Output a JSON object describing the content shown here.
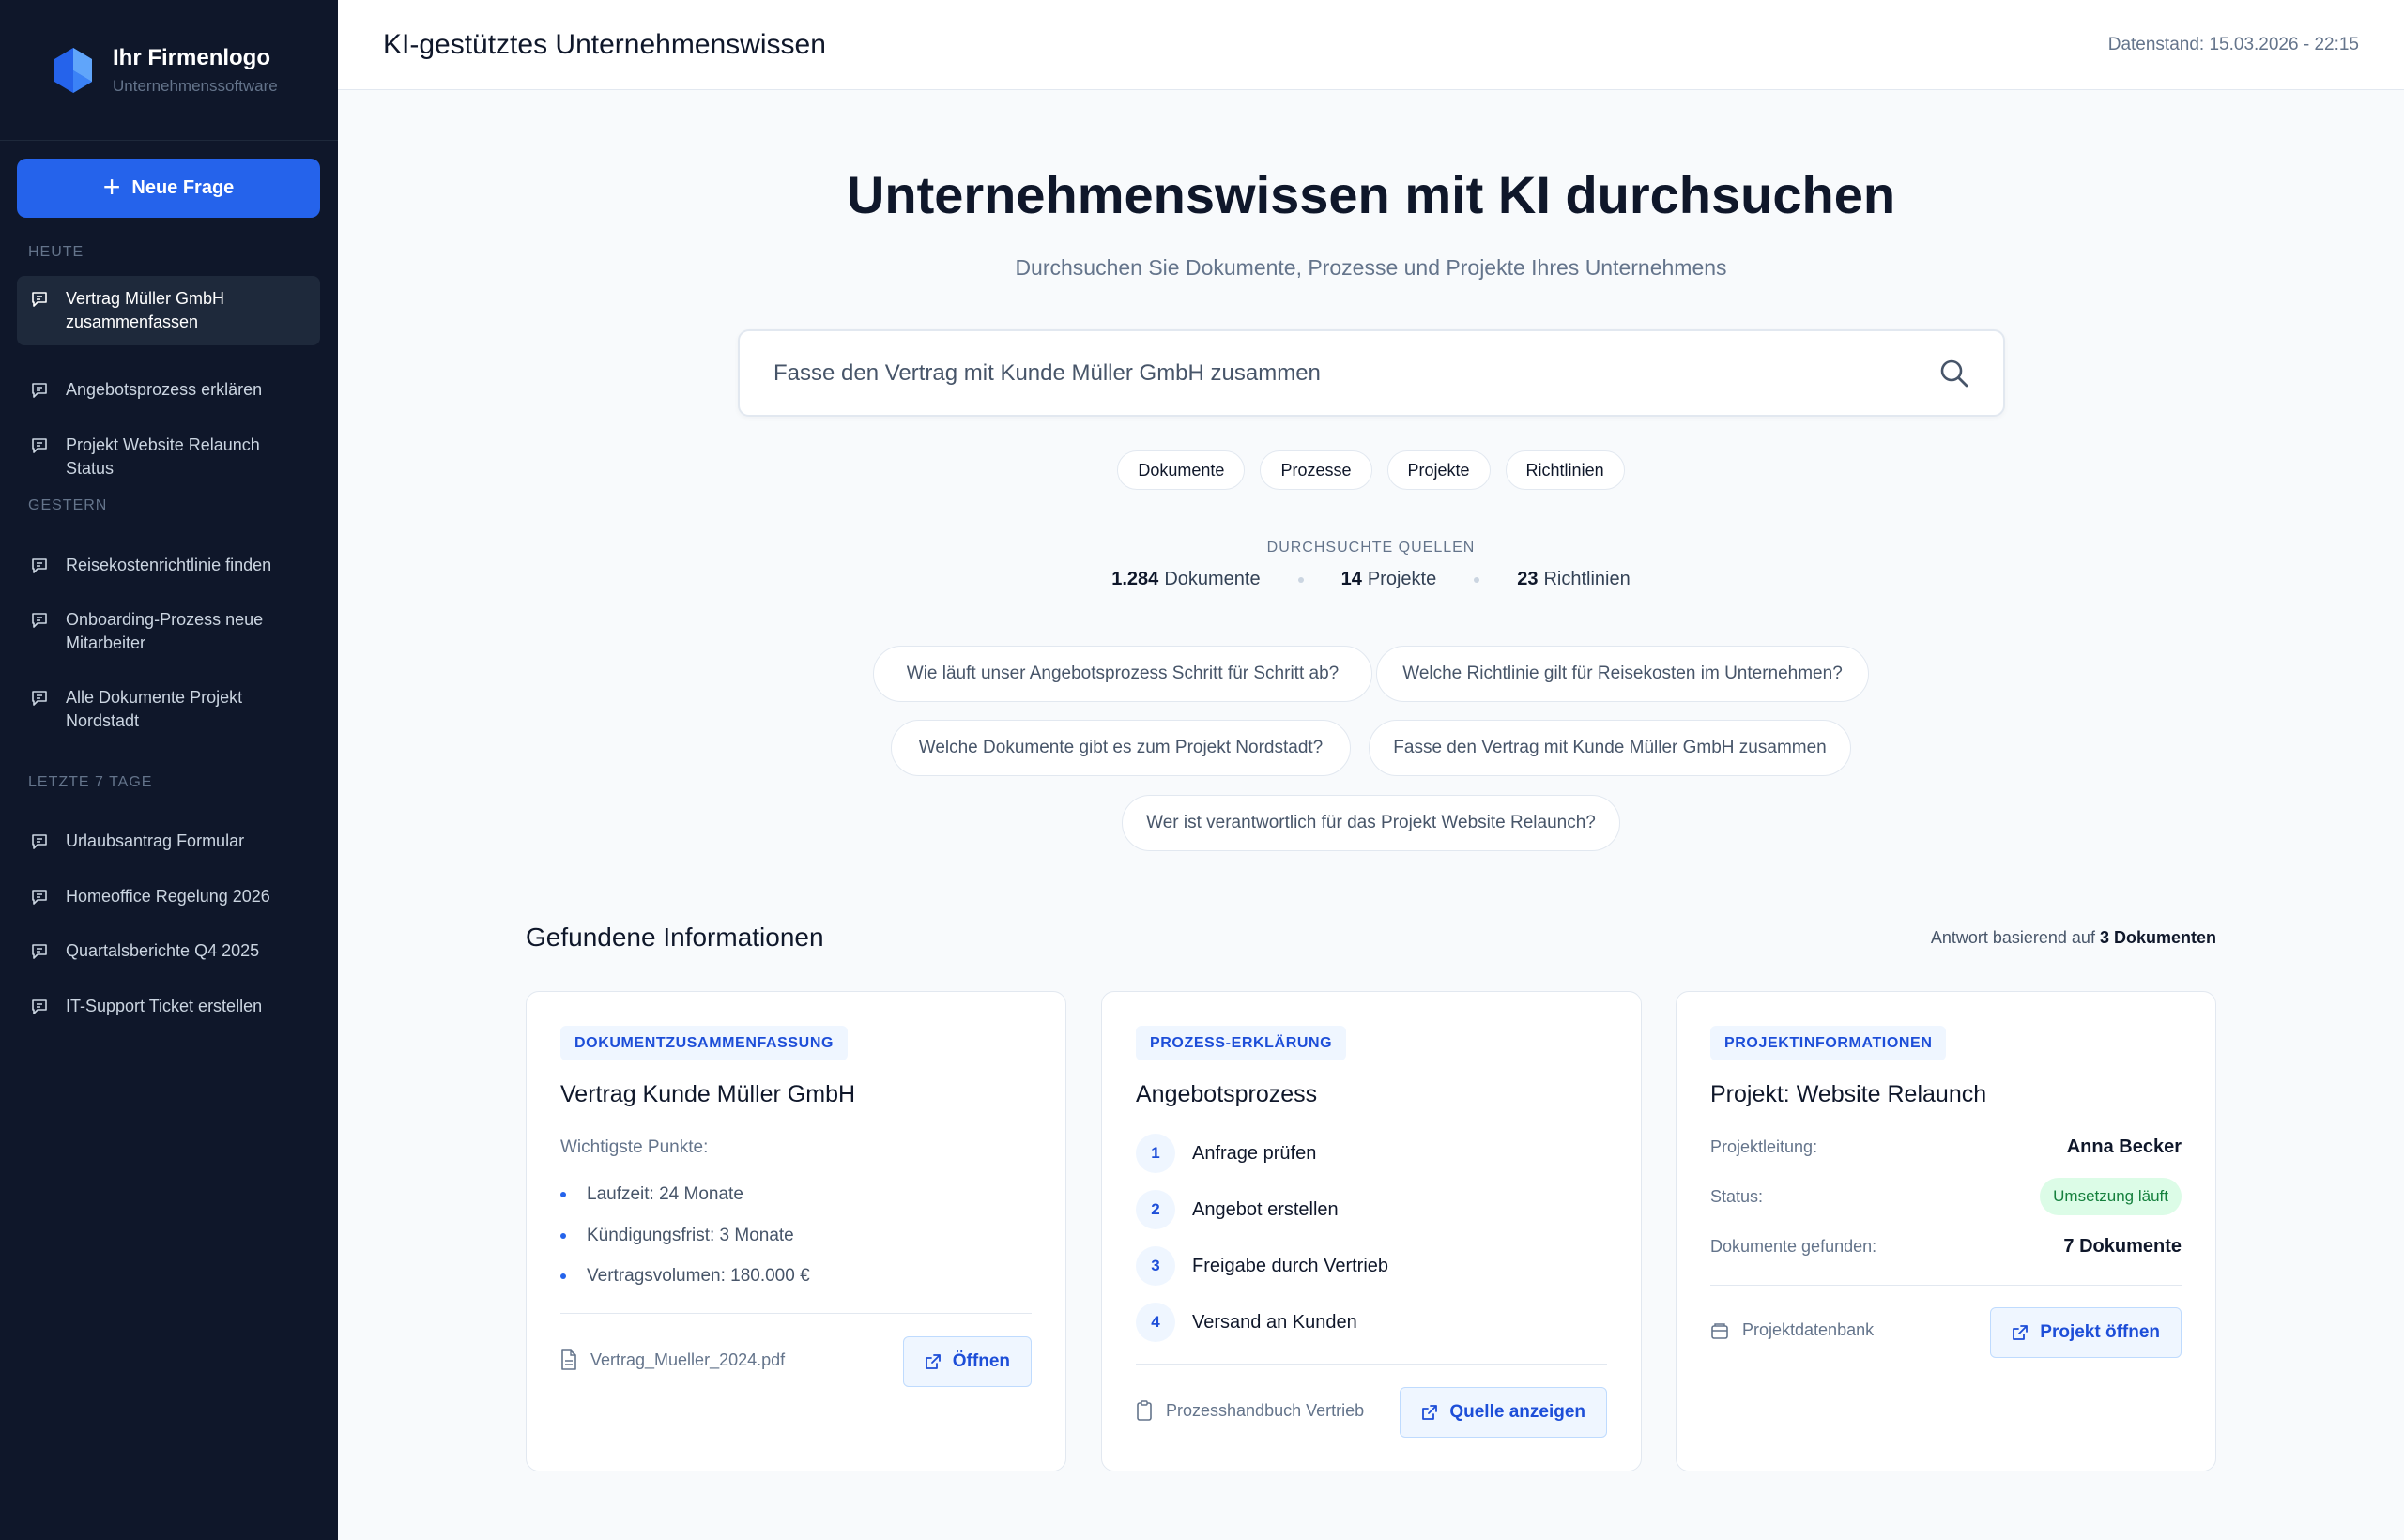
{
  "colors": {
    "accent": "#2563eb",
    "sidebar": "#0f172a",
    "status_green": "#15803d"
  },
  "brand": {
    "title": "Ihr Firmenlogo",
    "subtitle": "Unternehmenssoftware"
  },
  "sidebar": {
    "new_button": "Neue Frage",
    "sections": [
      {
        "label": "HEUTE",
        "items": [
          "Vertrag Müller GmbH zusammenfassen",
          "Angebotsprozess erklären",
          "Projekt Website Relaunch Status"
        ]
      },
      {
        "label": "GESTERN",
        "items": [
          "Reisekostenrichtlinie finden",
          "Onboarding-Prozess neue Mitarbeiter",
          "Alle Dokumente Projekt Nordstadt"
        ]
      },
      {
        "label": "LETZTE 7 TAGE",
        "items": [
          "Urlaubsantrag Formular",
          "Homeoffice Regelung 2026",
          "Quartalsberichte Q4 2025",
          "IT-Support Ticket erstellen"
        ]
      }
    ]
  },
  "header": {
    "title": "KI-gestütztes Unternehmenswissen",
    "data_status": "Datenstand: 15.03.2026 - 22:15"
  },
  "hero": {
    "title": "Unternehmenswissen mit KI durchsuchen",
    "subtitle": "Durchsuchen Sie Dokumente, Prozesse und Projekte Ihres Unternehmens"
  },
  "search": {
    "placeholder": "Fasse den Vertrag mit Kunde Müller GmbH zusammen"
  },
  "filters": [
    "Dokumente",
    "Prozesse",
    "Projekte",
    "Richtlinien"
  ],
  "sources": {
    "label": "DURCHSUCHTE QUELLEN",
    "items": [
      {
        "count": "1.284",
        "label": "Dokumente"
      },
      {
        "count": "14",
        "label": "Projekte"
      },
      {
        "count": "23",
        "label": "Richtlinien"
      }
    ]
  },
  "suggestions": [
    "Wie läuft unser Angebotsprozess Schritt für Schritt ab?",
    "Welche Richtlinie gilt für Reisekosten im Unternehmen?",
    "Welche Dokumente gibt es zum Projekt Nordstadt?",
    "Fasse den Vertrag mit Kunde Müller GmbH zusammen",
    "Wer ist verantwortlich für das Projekt Website Relaunch?"
  ],
  "results": {
    "title": "Gefundene Informationen",
    "meta_prefix": "Antwort basierend auf",
    "meta_count": "3 Dokumenten",
    "cards": [
      {
        "tag": "DOKUMENTZUSAMMENFASSUNG",
        "title": "Vertrag Kunde Müller GmbH",
        "key_points_label": "Wichtigste Punkte:",
        "points": [
          "Laufzeit: 24 Monate",
          "Kündigungsfrist: 3 Monate",
          "Vertragsvolumen: 180.000 €"
        ],
        "source": "Vertrag_Mueller_2024.pdf",
        "button": "Öffnen"
      },
      {
        "tag": "PROZESS-ERKLÄRUNG",
        "title": "Angebotsprozess",
        "steps": [
          {
            "n": "1",
            "label": "Anfrage prüfen"
          },
          {
            "n": "2",
            "label": "Angebot erstellen"
          },
          {
            "n": "3",
            "label": "Freigabe durch Vertrieb"
          },
          {
            "n": "4",
            "label": "Versand an Kunden"
          }
        ],
        "source": "Prozesshandbuch Vertrieb",
        "button": "Quelle anzeigen"
      },
      {
        "tag": "PROJEKTINFORMATIONEN",
        "title": "Projekt: Website Relaunch",
        "lead_label": "Projektleitung:",
        "lead_value": "Anna Becker",
        "status_label": "Status:",
        "status_value": "Umsetzung läuft",
        "docs_label": "Dokumente gefunden:",
        "docs_value": "7 Dokumente",
        "source": "Projektdatenbank",
        "button": "Projekt öffnen"
      }
    ]
  }
}
